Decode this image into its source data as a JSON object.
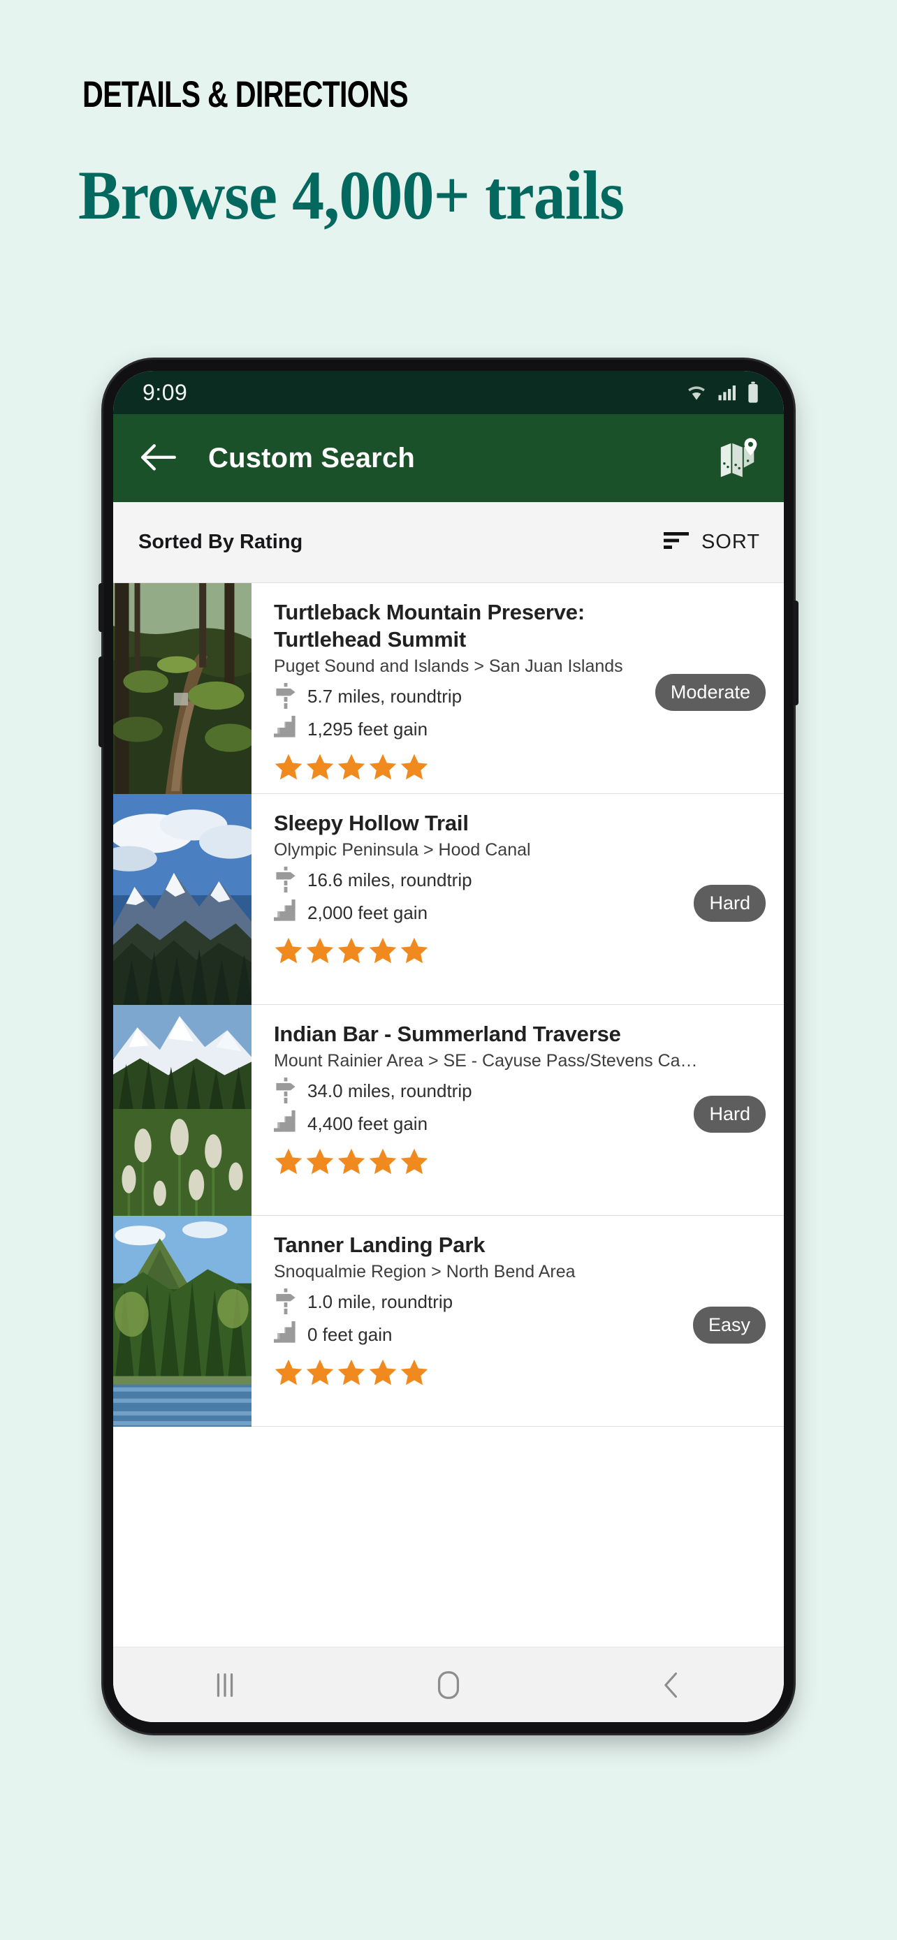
{
  "promo": {
    "kicker": "DETAILS & DIRECTIONS",
    "title": "Browse 4,000+ trails",
    "bg_color": "#e6f4ef",
    "title_color": "#03685e",
    "kicker_color": "#000000"
  },
  "status_bar": {
    "time": "9:09",
    "icons": [
      "wifi-icon",
      "cellular-signal-icon",
      "battery-icon"
    ],
    "bg_color": "#0b2c20"
  },
  "app_bar": {
    "back_label": "back-arrow-icon",
    "title": "Custom Search",
    "map_label": "map-icon",
    "bg_color": "#1b5129"
  },
  "sort_bar": {
    "sorted_label": "Sorted By Rating",
    "sort_button": "SORT"
  },
  "trails": [
    {
      "name": "Turtleback Mountain Preserve: Turtlehead Summit",
      "region": "Puget Sound and Islands > San Juan Islands",
      "distance": "5.7 miles, roundtrip",
      "elevation": "1,295 feet gain",
      "difficulty": "Moderate",
      "rating": 5,
      "thumb": "mossy-forest-trail"
    },
    {
      "name": "Sleepy Hollow Trail",
      "region": "Olympic Peninsula > Hood Canal",
      "distance": "16.6 miles, roundtrip",
      "elevation": "2,000 feet gain",
      "difficulty": "Hard",
      "rating": 5,
      "thumb": "snowy-mountain-clouds"
    },
    {
      "name": "Indian Bar - Summerland Traverse",
      "region": "Mount Rainier Area > SE - Cayuse Pass/Stevens Ca…",
      "distance": "34.0 miles, roundtrip",
      "elevation": "4,400 feet gain",
      "difficulty": "Hard",
      "rating": 5,
      "thumb": "beargrass-meadow-rainier"
    },
    {
      "name": "Tanner Landing Park",
      "region": "Snoqualmie Region > North Bend Area",
      "distance": "1.0 mile, roundtrip",
      "elevation": "0 feet gain",
      "difficulty": "Easy",
      "rating": 5,
      "thumb": "river-forest-bluff"
    }
  ],
  "nav_bar": {
    "recents": "recents-icon",
    "home": "home-icon",
    "back": "back-icon"
  },
  "colors": {
    "star": "#F08A1E",
    "difficulty_badge": "#5e5e5e",
    "stat_icon": "#9a9a9a"
  }
}
